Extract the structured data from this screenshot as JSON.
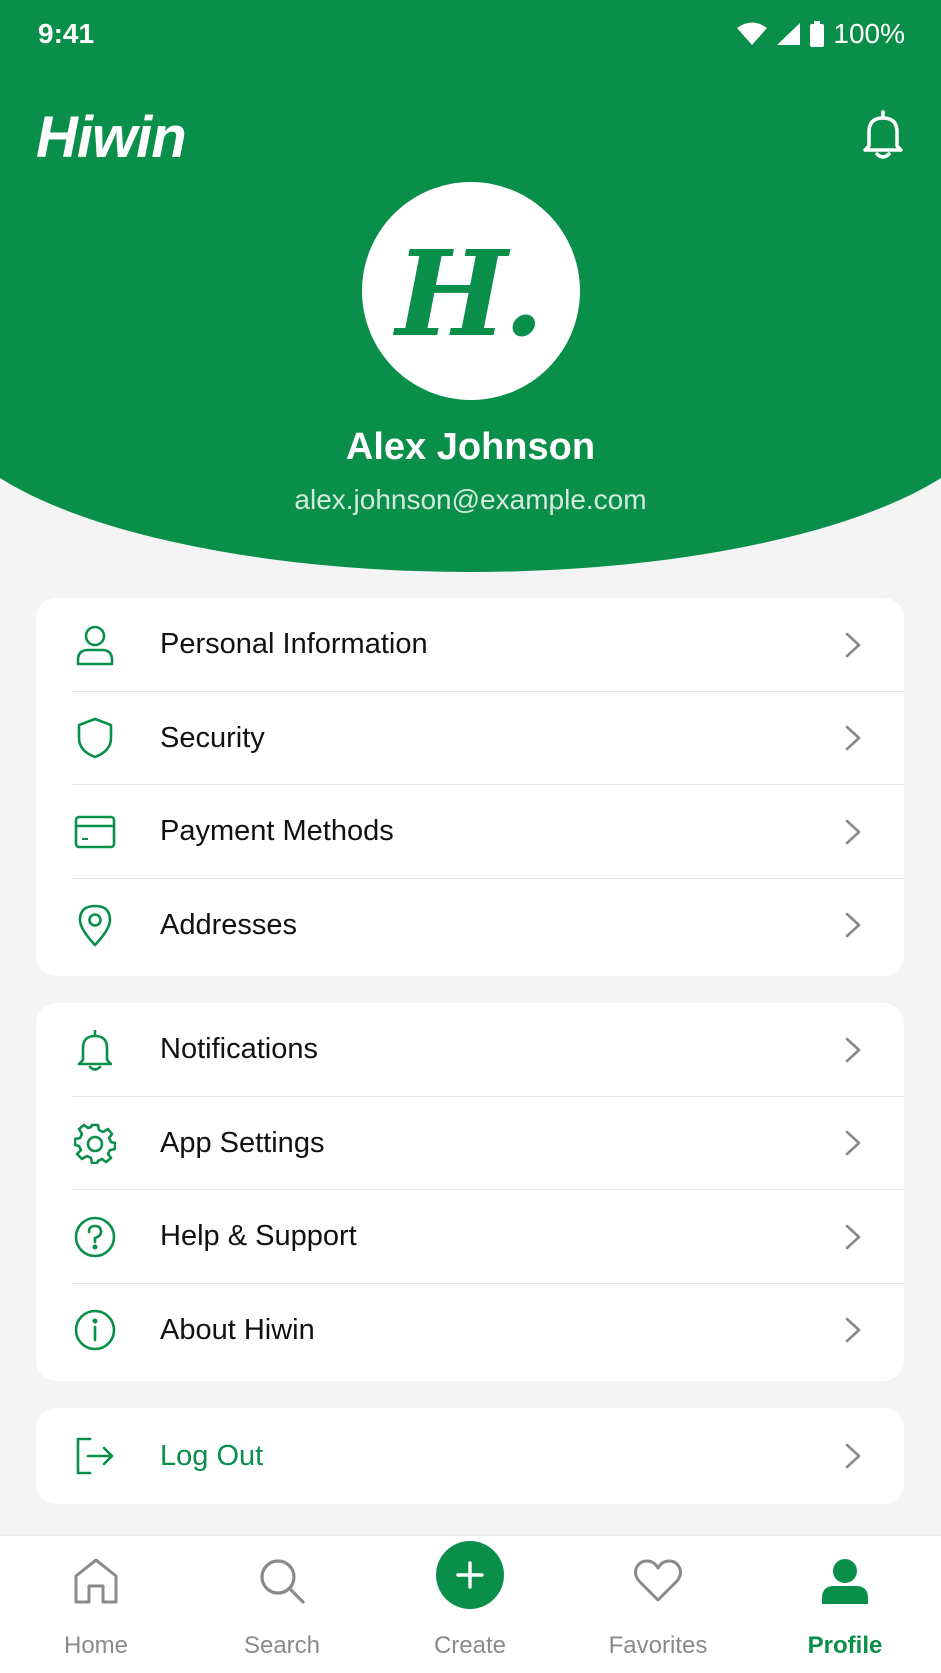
{
  "status": {
    "time": "9:41",
    "battery": "100%"
  },
  "app": {
    "brand": "Hiwin"
  },
  "profile": {
    "avatar_initial": "H.",
    "name": "Alex Johnson",
    "email": "alex.johnson@example.com"
  },
  "account_menu": [
    {
      "label": "Personal Information",
      "icon": "user-icon"
    },
    {
      "label": "Security",
      "icon": "shield-icon"
    },
    {
      "label": "Payment Methods",
      "icon": "credit-card-icon"
    },
    {
      "label": "Addresses",
      "icon": "map-pin-icon"
    }
  ],
  "app_menu": [
    {
      "label": "Notifications",
      "icon": "bell-icon"
    },
    {
      "label": "App Settings",
      "icon": "gear-icon"
    },
    {
      "label": "Help & Support",
      "icon": "help-circle-icon"
    },
    {
      "label": "About Hiwin",
      "icon": "info-circle-icon"
    }
  ],
  "logout": {
    "label": "Log Out",
    "icon": "logout-icon"
  },
  "bottom_nav": [
    {
      "label": "Home",
      "icon": "home-icon"
    },
    {
      "label": "Search",
      "icon": "search-icon"
    },
    {
      "label": "Create",
      "icon": "plus-icon"
    },
    {
      "label": "Favorites",
      "icon": "heart-icon"
    },
    {
      "label": "Profile",
      "icon": "user-filled-icon",
      "active": true
    }
  ],
  "colors": {
    "brand_green": "#0a8f4a",
    "background": "#f4f4f4",
    "inactive": "#8a8a8a"
  }
}
